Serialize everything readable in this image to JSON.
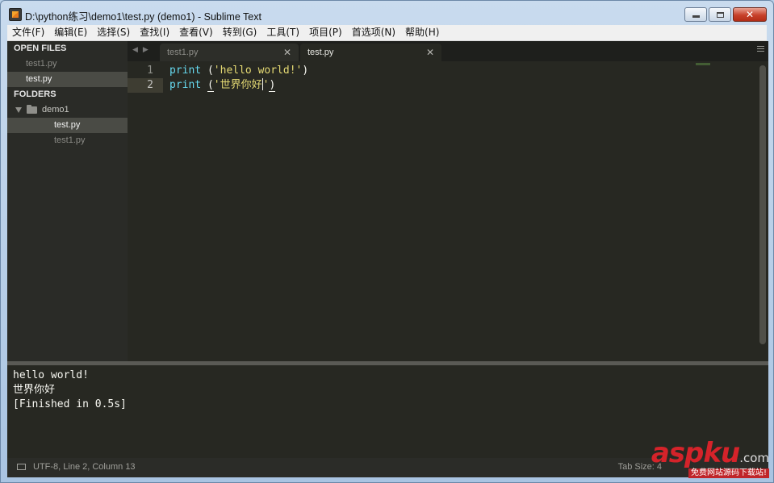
{
  "window": {
    "title": "D:\\python练习\\demo1\\test.py (demo1) - Sublime Text",
    "close_label": "✕"
  },
  "menu": [
    "文件(F)",
    "编辑(E)",
    "选择(S)",
    "查找(I)",
    "查看(V)",
    "转到(G)",
    "工具(T)",
    "项目(P)",
    "首选项(N)",
    "帮助(H)"
  ],
  "sidebar": {
    "open_files_header": "OPEN FILES",
    "open_files": [
      "test1.py",
      "test.py"
    ],
    "folders_header": "FOLDERS",
    "folder_name": "demo1",
    "folder_files": [
      "test.py",
      "test1.py"
    ]
  },
  "tabs": {
    "prev_arrow": "◀",
    "next_arrow": "▶",
    "items": [
      {
        "label": "test1.py",
        "close": "✕"
      },
      {
        "label": "test.py",
        "close": "✕"
      }
    ]
  },
  "editor": {
    "line_numbers": [
      "1",
      "2"
    ],
    "line1": {
      "keyword": "print",
      "open": " (",
      "string": "'hello world!'",
      "close": ")"
    },
    "line2": {
      "keyword": "print",
      "space": " ",
      "open": "(",
      "string_a": "'世界你好",
      "string_b": "'",
      "close": ")"
    }
  },
  "output": {
    "lines": [
      "hello world!",
      "世界你好",
      "[Finished in 0.5s]"
    ]
  },
  "status": {
    "left": "UTF-8, Line 2, Column 13",
    "right": "Tab Size: 4"
  },
  "watermark": {
    "brand": "aspku",
    "domain": ".com",
    "tagline": "免费网站源码下载站!"
  }
}
